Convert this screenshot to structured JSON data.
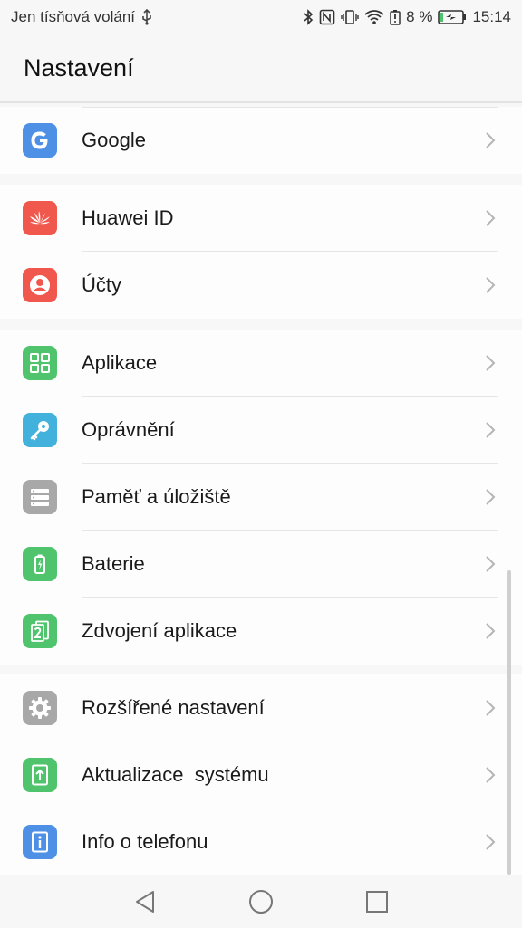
{
  "status_bar": {
    "carrier": "Jen tísňová volání",
    "battery_percent": "8 %",
    "time": "15:14",
    "icons": [
      "usb-icon",
      "bluetooth-icon",
      "nfc-icon",
      "vibrate-icon",
      "wifi-icon",
      "battery-alert-icon",
      "battery-charging-icon"
    ]
  },
  "header": {
    "title": "Nastavení"
  },
  "groups": [
    {
      "items": [
        {
          "label": "Google",
          "icon": "google-icon",
          "color": "#4d90e6"
        }
      ]
    },
    {
      "items": [
        {
          "label": "Huawei ID",
          "icon": "huawei-icon",
          "color": "#f0584e"
        },
        {
          "label": "Účty",
          "icon": "account-icon",
          "color": "#f0584e"
        }
      ]
    },
    {
      "items": [
        {
          "label": "Aplikace",
          "icon": "apps-grid-icon",
          "color": "#4fc46d"
        },
        {
          "label": "Oprávnění",
          "icon": "key-icon",
          "color": "#42b1dc"
        },
        {
          "label": "Paměť a úložiště",
          "icon": "storage-icon",
          "color": "#a8a8a8"
        },
        {
          "label": "Baterie",
          "icon": "battery-icon",
          "color": "#4fc46d"
        },
        {
          "label": "Zdvojení aplikace",
          "icon": "app-twin-icon",
          "color": "#4fc46d"
        }
      ]
    },
    {
      "items": [
        {
          "label": "Rozšířené nastavení",
          "icon": "gear-icon",
          "color": "#a8a8a8"
        },
        {
          "label": "Aktualizace  systému",
          "icon": "system-update-icon",
          "color": "#4fc46d"
        },
        {
          "label": "Info o telefonu",
          "icon": "info-icon",
          "color": "#4d90e6"
        }
      ]
    }
  ],
  "navbar": {
    "icons": [
      "back-icon",
      "home-icon",
      "recents-icon"
    ]
  }
}
